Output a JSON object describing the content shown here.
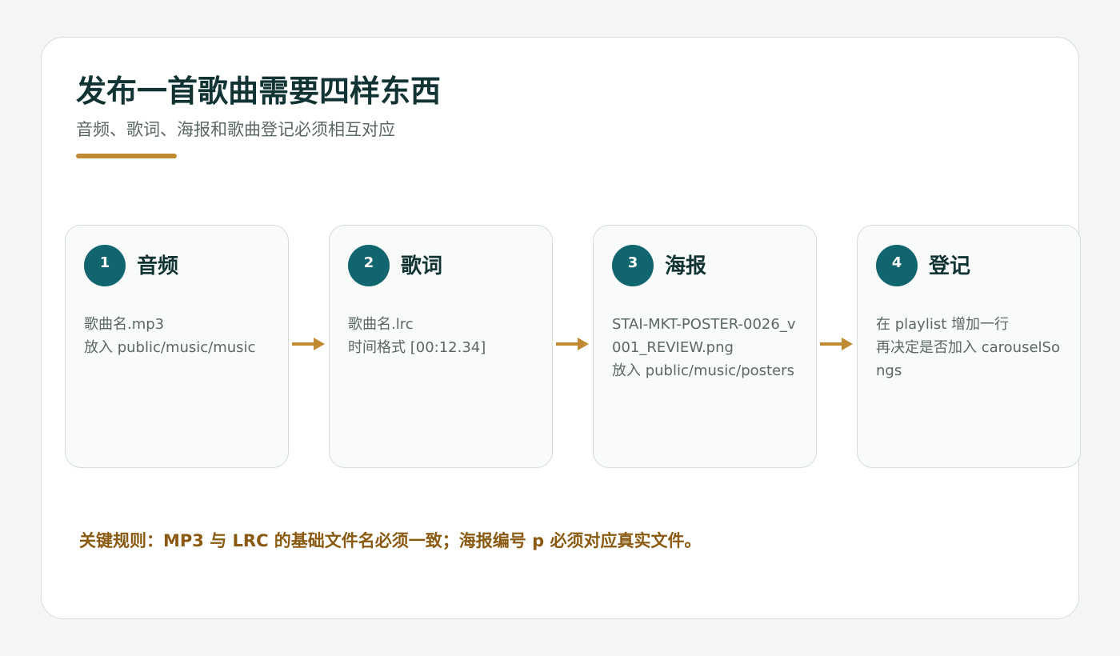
{
  "header": {
    "title": "发布一首歌曲需要四样东西",
    "subtitle": "音频、歌词、海报和歌曲登记必须相互对应"
  },
  "steps": [
    {
      "number": "1",
      "title": "音频",
      "lines": [
        "歌曲名.mp3",
        "放入 public/music/music"
      ]
    },
    {
      "number": "2",
      "title": "歌词",
      "lines": [
        "歌曲名.lrc",
        "时间格式 [00:12.34]"
      ]
    },
    {
      "number": "3",
      "title": "海报",
      "lines": [
        "STAI-MKT-POSTER-0026_v001_REVIEW.png",
        "放入 public/music/posters"
      ]
    },
    {
      "number": "4",
      "title": "登记",
      "lines": [
        "在 playlist 增加一行",
        "再决定是否加入 carouselSongs"
      ]
    }
  ],
  "rule_note": "关键规则：MP3 与 LRC 的基础文件名必须一致；海报编号 p 必须对应真实文件。",
  "colors": {
    "accent": "#c08a33",
    "step_circle": "#10656e",
    "title_text": "#123333",
    "rule_text": "#8a5a12"
  }
}
